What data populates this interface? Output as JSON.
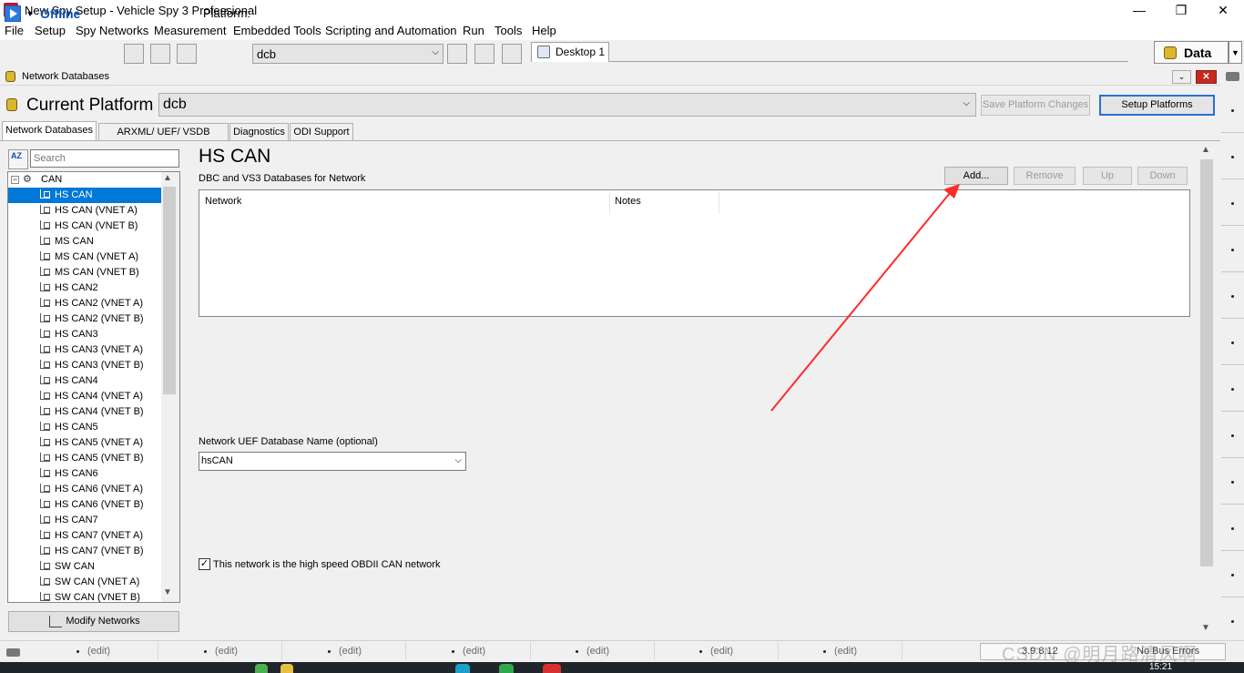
{
  "window": {
    "title": "New Spy Setup - Vehicle Spy 3 Professional",
    "minimize": "—",
    "maximize": "❐",
    "close": "✕"
  },
  "menu": [
    "File",
    "Setup",
    "Spy Networks",
    "Measurement",
    "Embedded Tools",
    "Scripting and Automation",
    "Run",
    "Tools",
    "Help"
  ],
  "toolbar": {
    "status": "Offline",
    "platform_label": "Platform:",
    "platform_value": "dcb",
    "desktop_tab": "Desktop 1",
    "data_button": "Data"
  },
  "panel": {
    "title": "Network Databases",
    "current_platform_label": "Current Platform",
    "current_platform_value": "dcb",
    "save_platform_changes": "Save Platform Changes",
    "setup_platforms": "Setup Platforms",
    "tabs": [
      "Network Databases",
      "ARXML/ UEF/ VSDB Support",
      "Diagnostics",
      "ODI Support"
    ],
    "active_tab": "Network Databases"
  },
  "tree": {
    "search_placeholder": "Search",
    "sort_icon": "AZ",
    "root": "CAN",
    "selected": "HS CAN",
    "items": [
      "HS CAN",
      "HS CAN (VNET A)",
      "HS CAN (VNET B)",
      "MS CAN",
      "MS CAN (VNET A)",
      "MS CAN (VNET B)",
      "HS CAN2",
      "HS CAN2 (VNET A)",
      "HS CAN2 (VNET B)",
      "HS CAN3",
      "HS CAN3 (VNET A)",
      "HS CAN3 (VNET B)",
      "HS CAN4",
      "HS CAN4 (VNET A)",
      "HS CAN4 (VNET B)",
      "HS CAN5",
      "HS CAN5 (VNET A)",
      "HS CAN5 (VNET B)",
      "HS CAN6",
      "HS CAN6 (VNET A)",
      "HS CAN6 (VNET B)",
      "HS CAN7",
      "HS CAN7 (VNET A)",
      "HS CAN7 (VNET B)",
      "SW CAN",
      "SW CAN (VNET A)",
      "SW CAN (VNET B)"
    ],
    "modify_networks": "Modify Networks"
  },
  "details": {
    "network_title": "HS CAN",
    "subtitle": "DBC and VS3 Databases for Network",
    "buttons": {
      "add": "Add...",
      "remove": "Remove",
      "up": "Up",
      "down": "Down"
    },
    "columns": [
      "Network",
      "Notes"
    ],
    "uef_label": "Network UEF Database Name (optional)",
    "uef_value": "hsCAN",
    "obdii_checked": true,
    "obdii_label": "This network is the high speed OBDII CAN network",
    "check_mark": "✓"
  },
  "annotation": {
    "color": "#ff2a2a"
  },
  "statusbar": {
    "cells": [
      "(edit)",
      "(edit)",
      "(edit)",
      "(edit)",
      "(edit)",
      "(edit)",
      "(edit)"
    ],
    "version": "3.9.8.12",
    "bus_status": "No Bus Errors",
    "watermark": "CSDN @明月路清风啊",
    "clock": "15:21"
  },
  "icons": {
    "up": "▲",
    "down": "▼",
    "chevron": "⌵",
    "collapse": "⌄",
    "expander": "−",
    "network_tree": "⚙"
  }
}
